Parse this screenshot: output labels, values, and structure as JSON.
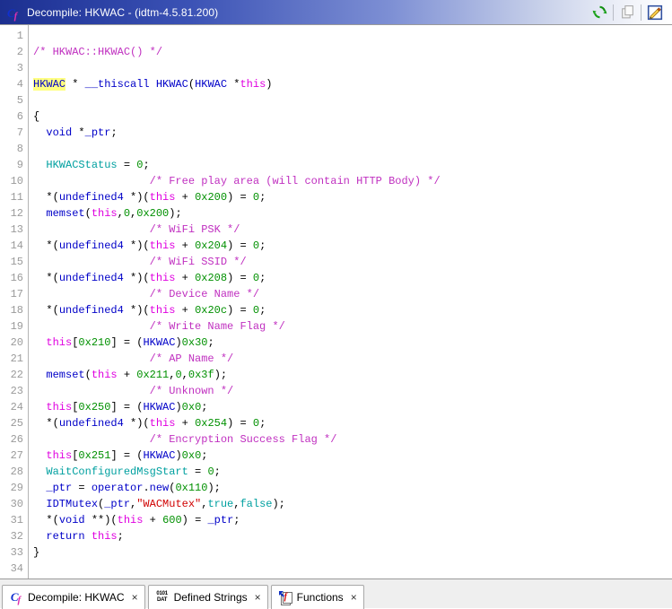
{
  "window": {
    "title": "Decompile: HKWAC  -  (idtm-4.5.81.200)",
    "icon_c": "C",
    "icon_f": "f"
  },
  "toolbar": {
    "refresh_label": "refresh-icon",
    "copy_label": "copy-icon",
    "edit_label": "edit-icon"
  },
  "editor": {
    "line_numbers": [
      "1",
      "2",
      "3",
      "4",
      "5",
      "6",
      "7",
      "8",
      "9",
      "10",
      "11",
      "12",
      "13",
      "14",
      "15",
      "16",
      "17",
      "18",
      "19",
      "20",
      "21",
      "22",
      "23",
      "24",
      "25",
      "26",
      "27",
      "28",
      "29",
      "30",
      "31",
      "32",
      "33",
      "34"
    ],
    "lines": [
      {
        "n": "1",
        "text": ""
      },
      {
        "n": "2",
        "text": "/* HKWAC::HKWAC() */"
      },
      {
        "n": "3",
        "text": ""
      },
      {
        "n": "4",
        "text": "HKWAC * __thiscall HKWAC(HKWAC *this)"
      },
      {
        "n": "5",
        "text": ""
      },
      {
        "n": "6",
        "text": "{"
      },
      {
        "n": "7",
        "text": "  void *_ptr;"
      },
      {
        "n": "8",
        "text": ""
      },
      {
        "n": "9",
        "text": "  HKWACStatus = 0;"
      },
      {
        "n": "10",
        "text": "                  /* Free play area (will contain HTTP Body) */"
      },
      {
        "n": "11",
        "text": "  *(undefined4 *)(this + 0x200) = 0;"
      },
      {
        "n": "12",
        "text": "  memset(this,0,0x200);"
      },
      {
        "n": "13",
        "text": "                  /* WiFi PSK */"
      },
      {
        "n": "14",
        "text": "  *(undefined4 *)(this + 0x204) = 0;"
      },
      {
        "n": "15",
        "text": "                  /* WiFi SSID */"
      },
      {
        "n": "16",
        "text": "  *(undefined4 *)(this + 0x208) = 0;"
      },
      {
        "n": "17",
        "text": "                  /* Device Name */"
      },
      {
        "n": "18",
        "text": "  *(undefined4 *)(this + 0x20c) = 0;"
      },
      {
        "n": "19",
        "text": "                  /* Write Name Flag */"
      },
      {
        "n": "20",
        "text": "  this[0x210] = (HKWAC)0x30;"
      },
      {
        "n": "21",
        "text": "                  /* AP Name */"
      },
      {
        "n": "22",
        "text": "  memset(this + 0x211,0,0x3f);"
      },
      {
        "n": "23",
        "text": "                  /* Unknown */"
      },
      {
        "n": "24",
        "text": "  this[0x250] = (HKWAC)0x0;"
      },
      {
        "n": "25",
        "text": "  *(undefined4 *)(this + 0x254) = 0;"
      },
      {
        "n": "26",
        "text": "                  /* Encryption Success Flag */"
      },
      {
        "n": "27",
        "text": "  this[0x251] = (HKWAC)0x0;"
      },
      {
        "n": "28",
        "text": "  WaitConfiguredMsgStart = 0;"
      },
      {
        "n": "29",
        "text": "  _ptr = operator.new(0x110);"
      },
      {
        "n": "30",
        "text": "  IDTMutex(_ptr,\"WACMutex\",true,false);"
      },
      {
        "n": "31",
        "text": "  *(void **)(this + 600) = _ptr;"
      },
      {
        "n": "32",
        "text": "  return this;"
      },
      {
        "n": "33",
        "text": "}"
      },
      {
        "n": "34",
        "text": ""
      }
    ],
    "highlighted_token": "HKWAC"
  },
  "tabs": [
    {
      "label": "Decompile: HKWAC",
      "icon": "cf-icon",
      "close": "×",
      "active": true
    },
    {
      "label": "Defined Strings",
      "icon": "dat-icon",
      "close": "×",
      "active": false
    },
    {
      "label": "Functions",
      "icon": "functions-icon",
      "close": "×",
      "active": false
    }
  ],
  "tab_icon_dat": {
    "top": "0101",
    "bottom": "DAT"
  },
  "colors": {
    "titlebar_start": "#1c2f8f",
    "comment": "#c030c0",
    "type": "#0000c8",
    "global": "#00a0a0",
    "this": "#e000e0",
    "number": "#009000",
    "string": "#d00000",
    "highlight": "#ffff80"
  }
}
